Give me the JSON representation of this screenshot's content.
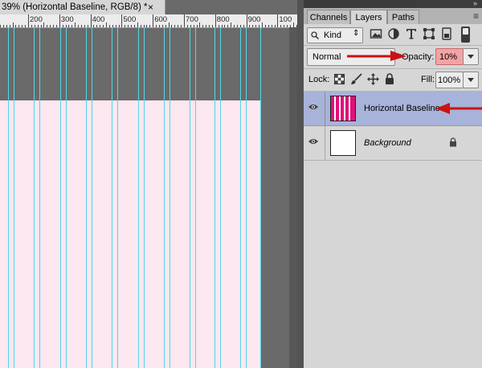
{
  "document": {
    "tab_title": "39% (Horizontal Baseline, RGB/8) *",
    "close_glyph": "×",
    "ruler_labels": [
      "200",
      "300",
      "400",
      "500",
      "600",
      "700",
      "800",
      "900",
      "100"
    ]
  },
  "panel": {
    "tabs": [
      {
        "label": "Channels",
        "active": false
      },
      {
        "label": "Layers",
        "active": true
      },
      {
        "label": "Paths",
        "active": false
      }
    ],
    "collapse_glyph": "»",
    "menu_glyph": "≡",
    "filter_kind": "Kind",
    "filter_icons": [
      "image-filter-icon",
      "adjustment-filter-icon",
      "type-filter-icon",
      "shape-filter-icon",
      "smart-object-filter-icon"
    ],
    "blend_mode": "Normal",
    "opacity_label": "Opacity:",
    "opacity_value": "10%",
    "lock_label": "Lock:",
    "lock_icons": [
      "lock-transparent-icon",
      "lock-image-icon",
      "lock-position-icon",
      "lock-all-icon"
    ],
    "fill_label": "Fill:",
    "fill_value": "100%",
    "layers": [
      {
        "name": "Horizontal Baseline",
        "selected": true,
        "visible": true,
        "italic": false,
        "locked": false
      },
      {
        "name": "Background",
        "selected": false,
        "visible": true,
        "italic": true,
        "locked": true
      }
    ]
  },
  "colors": {
    "canvas_pink": "#fde7f1",
    "guide_cyan": "#4fd8e8",
    "selected_layer": "#a7b3d9",
    "annotation_arrow": "#cc1111",
    "opacity_highlight": "#f4a3a3",
    "thumb_magenta": "#e0107a"
  }
}
